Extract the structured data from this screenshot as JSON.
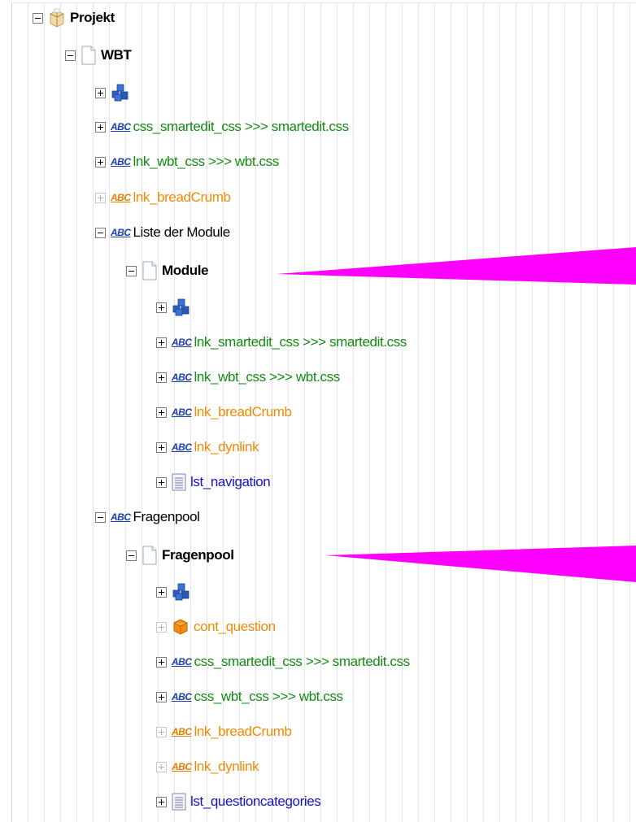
{
  "tree": {
    "root": {
      "label": "Projekt"
    },
    "wbt": {
      "label": "WBT",
      "items": [
        {
          "label": "",
          "icon": "components-icon"
        },
        {
          "label": "css_smartedit_css >>> smartedit.css",
          "icon": "abc-icon"
        },
        {
          "label": "lnk_wbt_css >>> wbt.css",
          "icon": "abc-icon"
        },
        {
          "label": "lnk_breadCrumb",
          "icon": "abc-icon"
        }
      ]
    },
    "liste": {
      "label": "Liste der Module",
      "page": {
        "label": "Module",
        "items": [
          {
            "label": "",
            "icon": "components-icon"
          },
          {
            "label": "lnk_smartedit_css >>> smartedit.css",
            "icon": "abc-icon"
          },
          {
            "label": "lnk_wbt_css >>> wbt.css",
            "icon": "abc-icon"
          },
          {
            "label": "lnk_breadCrumb",
            "icon": "abc-icon"
          },
          {
            "label": "lnk_dynlink",
            "icon": "abc-icon"
          },
          {
            "label": "lst_navigation",
            "icon": "list-icon"
          }
        ]
      }
    },
    "fragenpool": {
      "label": "Fragenpool",
      "page": {
        "label": "Fragenpool",
        "items": [
          {
            "label": "",
            "icon": "components-icon"
          },
          {
            "label": "cont_question",
            "icon": "container-icon"
          },
          {
            "label": "css_smartedit_css >>> smartedit.css",
            "icon": "abc-icon"
          },
          {
            "label": "css_wbt_css >>> wbt.css",
            "icon": "abc-icon"
          },
          {
            "label": "lnk_breadCrumb",
            "icon": "abc-icon"
          },
          {
            "label": "lnk_dynlink",
            "icon": "abc-icon"
          },
          {
            "label": "lst_questioncategories",
            "icon": "list-icon"
          }
        ]
      }
    }
  },
  "abc_icon_text": "ABC",
  "colors": {
    "callout": "#ff00ff",
    "green_text": "#138a13",
    "orange_text": "#ef8a06",
    "blue_text": "#1313c8",
    "abc_blue": "#1b3ea8"
  }
}
